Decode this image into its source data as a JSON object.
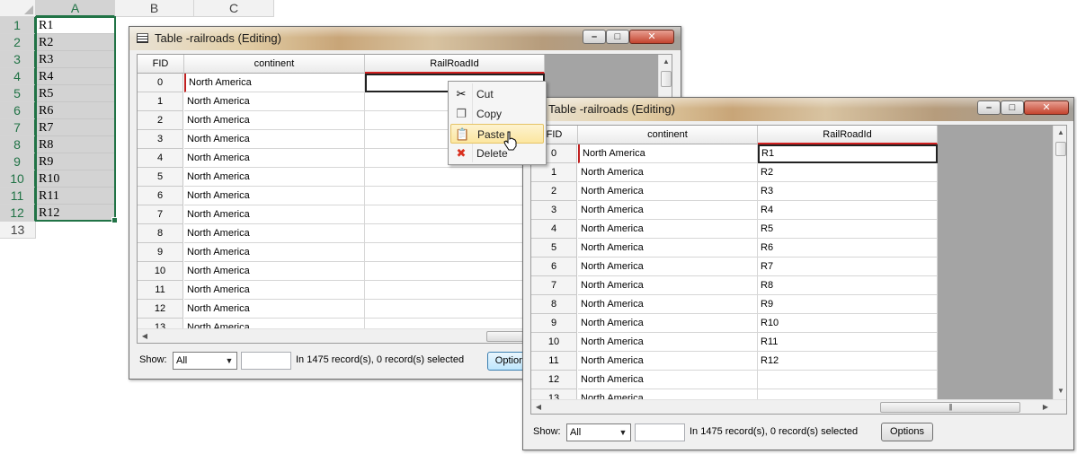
{
  "spreadsheet": {
    "columns": [
      "A",
      "B",
      "C"
    ],
    "selected_column": "A",
    "row_numbers": [
      "1",
      "2",
      "3",
      "4",
      "5",
      "6",
      "7",
      "8",
      "9",
      "10",
      "11",
      "12",
      "13"
    ],
    "values": [
      "R1",
      "R2",
      "R3",
      "R4",
      "R5",
      "R6",
      "R7",
      "R8",
      "R9",
      "R10",
      "R11",
      "R12"
    ],
    "accent_color": "#217346"
  },
  "window_back": {
    "title": "Table -railroads (Editing)",
    "controls": {
      "minimize": "–",
      "maximize": "□",
      "close": "✕"
    },
    "headers": [
      "FID",
      "continent",
      "RailRoadId"
    ],
    "rows": [
      {
        "fid": "0",
        "continent": "North America",
        "railroad_id": ""
      },
      {
        "fid": "1",
        "continent": "North America",
        "railroad_id": ""
      },
      {
        "fid": "2",
        "continent": "North America",
        "railroad_id": ""
      },
      {
        "fid": "3",
        "continent": "North America",
        "railroad_id": ""
      },
      {
        "fid": "4",
        "continent": "North America",
        "railroad_id": ""
      },
      {
        "fid": "5",
        "continent": "North America",
        "railroad_id": ""
      },
      {
        "fid": "6",
        "continent": "North America",
        "railroad_id": ""
      },
      {
        "fid": "7",
        "continent": "North America",
        "railroad_id": ""
      },
      {
        "fid": "8",
        "continent": "North America",
        "railroad_id": ""
      },
      {
        "fid": "9",
        "continent": "North America",
        "railroad_id": ""
      },
      {
        "fid": "10",
        "continent": "North America",
        "railroad_id": ""
      },
      {
        "fid": "11",
        "continent": "North America",
        "railroad_id": ""
      },
      {
        "fid": "12",
        "continent": "North America",
        "railroad_id": ""
      },
      {
        "fid": "13",
        "continent": "North America",
        "railroad_id": ""
      }
    ],
    "footer": {
      "show_label": "Show:",
      "show_value": "All",
      "records_text": "In 1475 record(s), 0 record(s) selected",
      "options_label": "Option"
    }
  },
  "context_menu": {
    "items": [
      {
        "label": "Cut",
        "icon": "scissors-icon"
      },
      {
        "label": "Copy",
        "icon": "copy-icon"
      },
      {
        "label": "Paste",
        "icon": "clipboard-icon"
      },
      {
        "label": "Delete",
        "icon": "delete-x-icon"
      }
    ],
    "highlighted": "Paste"
  },
  "window_front": {
    "title": "Table -railroads (Editing)",
    "controls": {
      "minimize": "–",
      "maximize": "□",
      "close": "✕"
    },
    "headers": [
      "FID",
      "continent",
      "RailRoadId"
    ],
    "rows": [
      {
        "fid": "0",
        "continent": "North America",
        "railroad_id": "R1"
      },
      {
        "fid": "1",
        "continent": "North America",
        "railroad_id": "R2"
      },
      {
        "fid": "2",
        "continent": "North America",
        "railroad_id": "R3"
      },
      {
        "fid": "3",
        "continent": "North America",
        "railroad_id": "R4"
      },
      {
        "fid": "4",
        "continent": "North America",
        "railroad_id": "R5"
      },
      {
        "fid": "5",
        "continent": "North America",
        "railroad_id": "R6"
      },
      {
        "fid": "6",
        "continent": "North America",
        "railroad_id": "R7"
      },
      {
        "fid": "7",
        "continent": "North America",
        "railroad_id": "R8"
      },
      {
        "fid": "8",
        "continent": "North America",
        "railroad_id": "R9"
      },
      {
        "fid": "9",
        "continent": "North America",
        "railroad_id": "R10"
      },
      {
        "fid": "10",
        "continent": "North America",
        "railroad_id": "R11"
      },
      {
        "fid": "11",
        "continent": "North America",
        "railroad_id": "R12"
      },
      {
        "fid": "12",
        "continent": "North America",
        "railroad_id": ""
      },
      {
        "fid": "13",
        "continent": "North America",
        "railroad_id": ""
      }
    ],
    "footer": {
      "show_label": "Show:",
      "show_value": "All",
      "records_text": "In 1475 record(s), 0 record(s) selected",
      "options_label": "Options"
    }
  }
}
